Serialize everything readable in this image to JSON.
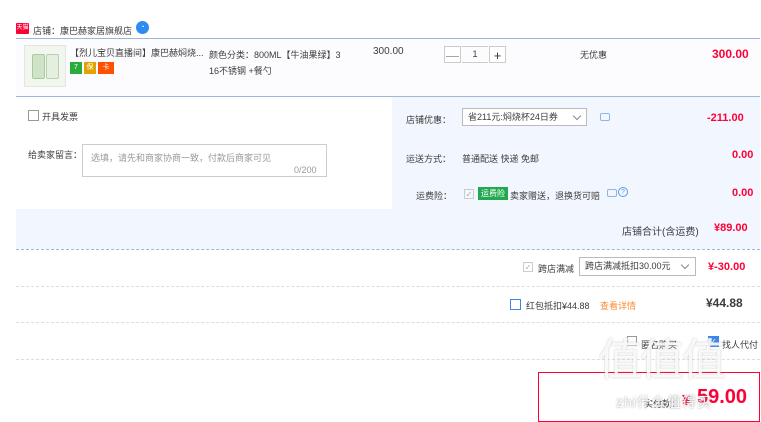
{
  "store": {
    "tag": "天猫",
    "name": "店铺：康巴赫家居旗舰店",
    "ww_icon": "chat-bubble-icon"
  },
  "item": {
    "title": "【烈儿宝贝直播间】康巴赫焖烧...",
    "badges": [
      "7",
      "保",
      "卡"
    ],
    "sku_line1": "颜色分类：800ML【牛油果绿】3",
    "sku_line2": "16不锈钢 +餐勺",
    "price": "300.00",
    "quantity": "1",
    "minus": "—",
    "plus": "+",
    "discount": "无优惠",
    "total": "300.00"
  },
  "options": {
    "invoice_label": "开具发票",
    "message_label": "给卖家留言：",
    "message_placeholder": "选填，请先和商家协商一致，付款后商家可见",
    "message_count": "0/200",
    "shop_discount_label": "店铺优惠：",
    "shop_discount_value": "省211元:焖烧杯24日券",
    "shop_discount_amount": "-211.00",
    "shipping_label": "运送方式：",
    "shipping_value": "普通配送 快递 免邮",
    "shipping_amount": "0.00",
    "insurance_label": "运费险：",
    "insurance_tag": "运费险",
    "insurance_value": "卖家赠送，退换货可赔",
    "insurance_amount": "0.00",
    "store_total_label": "店铺合计(含运费)",
    "store_total_value": "¥89.00"
  },
  "cross_store": {
    "label": "跨店满减",
    "select_value": "跨店满减抵扣30.00元",
    "amount": "¥-30.00"
  },
  "red_packet": {
    "label": "红包抵扣¥44.88",
    "detail_link": "查看详情",
    "amount": "¥44.88"
  },
  "bottom": {
    "anonymous_label": "匿名购买",
    "pay_other_label": "找人代付",
    "pay_label": "实付款：",
    "pay_symbol": "¥",
    "pay_value": "59.00"
  },
  "watermark": {
    "glyphs": "值值值",
    "domain": "zhi什么值得买"
  },
  "colors": {
    "accent": "#ff0036",
    "link_blue": "#3b86e8",
    "panel": "#f2f7ff",
    "insurance_green": "#22a94f"
  }
}
